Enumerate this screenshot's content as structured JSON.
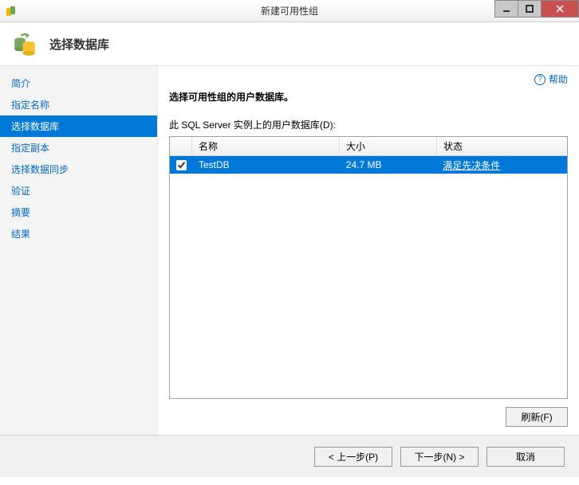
{
  "window": {
    "title": "新建可用性组"
  },
  "header": {
    "title": "选择数据库"
  },
  "sidebar": {
    "steps": [
      {
        "label": "简介"
      },
      {
        "label": "指定名称"
      },
      {
        "label": "选择数据库"
      },
      {
        "label": "指定副本"
      },
      {
        "label": "选择数据同步"
      },
      {
        "label": "验证"
      },
      {
        "label": "摘要"
      },
      {
        "label": "结果"
      }
    ],
    "current_index": 2
  },
  "main": {
    "help_label": "帮助",
    "instruction": "选择可用性组的用户数据库。",
    "subinstruction": "此 SQL Server 实例上的用户数据库(D):",
    "columns": {
      "name": "名称",
      "size": "大小",
      "status": "状态"
    },
    "rows": [
      {
        "checked": true,
        "name": "TestDB",
        "size": "24.7 MB",
        "status": "满足先决条件"
      }
    ],
    "refresh_label": "刷新(F)"
  },
  "footer": {
    "prev": "< 上一步(P)",
    "next": "下一步(N) >",
    "cancel": "取消"
  }
}
